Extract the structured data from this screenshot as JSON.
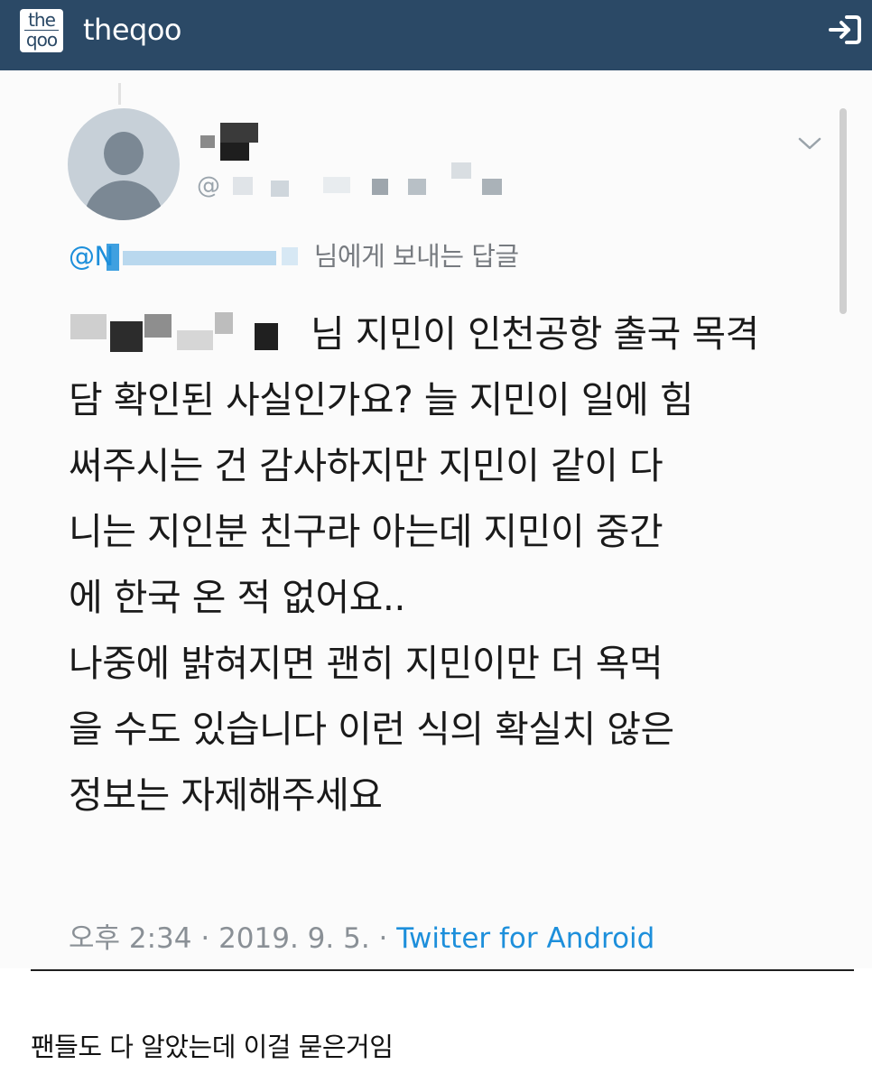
{
  "header": {
    "logo_line1": "the",
    "logo_line2": "qoo",
    "site_name": "theqoo",
    "login_icon": "login-arrow-icon",
    "background": "#2b4966"
  },
  "tweet": {
    "avatar_icon": "default-profile-avatar-icon",
    "handle_prefix": "@",
    "menu_icon": "chevron-down-icon",
    "reply_handle": "@N",
    "reply_suffix": "님에게 보내는 답글",
    "text_lines": [
      "님 지민이 인천공항 출국 목격",
      "담 확인된 사실인가요? 늘 지민이 일에 힘",
      "써주시는 건 감사하지만 지민이 같이 다",
      "니는 지인분 친구라 아는데 지민이 중간",
      "에 한국 온 적 없어요..",
      "나중에 밝혀지면 괜히 지민이만 더 욕먹",
      "을 수도 있습니다 이런 식의 확실치 않은",
      "정보는 자제해주세요"
    ],
    "time": "오후 2:34 · 2019. 9. 5. · ",
    "source": "Twitter for Android",
    "link_color": "#1d8fdb"
  },
  "caption": "팬들도 다 알았는데 이걸 묻은거임"
}
